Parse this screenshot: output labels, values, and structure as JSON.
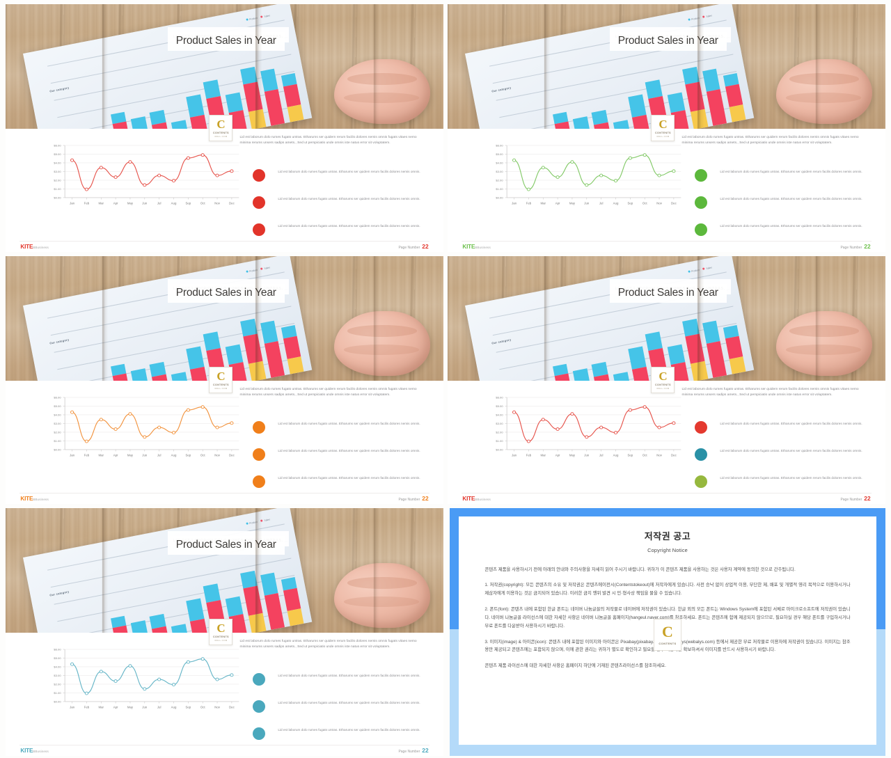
{
  "deck": {
    "slide_common": {
      "kicker": "LID EST LABORUM  DOLO  RUMES  FUGATS  UNTRAS.",
      "title": "Product Sales in Year",
      "lead_paragraph": "Lid est laborum dolo rumes fugats untras. Etharums ser quidem rerum facilis dolores nemis omnis fugats vitaes nemo minima rerums unsers sadips amets., Sed ut perspiciatis  unde omnis iste natus error sit voluptatem.",
      "bullet_text": "Lid est laborum dolo rumes fugats untras. Etharums ser quidem rerum facilis dolores nemis omnis.",
      "logo_letter": "C",
      "logo_name": "CONTENTS",
      "logo_sub": "MALL.COM",
      "paper_category_label": "Our category",
      "paper_legend": [
        "Product",
        "Sales"
      ],
      "footer": {
        "brand_bold": "KITE",
        "brand_light": "BBusiness",
        "page_label": "Page Number",
        "page_value": "22"
      }
    },
    "slides": [
      {
        "id": "slide-1",
        "accent": "#e2342a",
        "dots": [
          "#e2342a",
          "#e2342a",
          "#e2342a"
        ]
      },
      {
        "id": "slide-2",
        "accent": "#6cbf4b",
        "dots": [
          "#5cb83c",
          "#5cb83c",
          "#5cb83c"
        ]
      },
      {
        "id": "slide-3",
        "accent": "#f07f1a",
        "dots": [
          "#f07f1a",
          "#f07f1a",
          "#f07f1a"
        ]
      },
      {
        "id": "slide-4",
        "accent": "#e2342a",
        "dots": [
          "#e4392f",
          "#2a91a6",
          "#96b83e"
        ]
      },
      {
        "id": "slide-5",
        "accent": "#4aa8bd",
        "dots": [
          "#4aa8bd",
          "#4aa8bd",
          "#4aa8bd"
        ]
      }
    ]
  },
  "chart_data": {
    "type": "line",
    "title": "Product Sales in Year",
    "xlabel": "",
    "ylabel": "",
    "categories": [
      "Jan",
      "Feb",
      "Mar",
      "Apr",
      "May",
      "Jun",
      "Jul",
      "Aug",
      "Sep",
      "Oct",
      "Nov",
      "Dec"
    ],
    "values": [
      4.3,
      0.95,
      3.45,
      2.35,
      4.1,
      1.45,
      2.55,
      1.95,
      4.55,
      4.9,
      2.55,
      3.05
    ],
    "ytick_labels": [
      "$6.00",
      "$5.00",
      "$4.00",
      "$3.00",
      "$2.00",
      "$1.00",
      "$0.00"
    ],
    "ytick_values": [
      6,
      5,
      4,
      3,
      2,
      1,
      0
    ],
    "ylim": [
      0,
      6
    ],
    "grid": true,
    "legend": false,
    "markers": "open-circle",
    "series": [
      {
        "name": "Sales",
        "values": [
          4.3,
          0.95,
          3.45,
          2.35,
          4.1,
          1.45,
          2.55,
          1.95,
          4.55,
          4.9,
          2.55,
          3.05
        ]
      }
    ]
  },
  "paper_photo_chart": {
    "type": "bar",
    "stacked": true,
    "series": [
      {
        "name": "blue",
        "color": "#45c4e8"
      },
      {
        "name": "red",
        "color": "#f4425f"
      },
      {
        "name": "yellow",
        "color": "#f7c94b"
      }
    ]
  },
  "copyright": {
    "title": "저작권 공고",
    "subtitle": "Copyright Notice",
    "paragraphs": [
      "콘텐츠 제품을 사용하시기 전에 아래의 안내와 주의사항을 자세히 읽어 주시기 바랍니다. 귀하가 이 콘텐츠 제품을 사용하는 것은 사용자 계약에 동의한 것으로 간주됩니다.",
      "1. 저작권(copyright): 모든 콘텐츠의 소유 및 저작권은 콘텐츠에이전시(Contentstokeout)에 저작자에게 있습니다. 사전 승낙 없이 상업적 이용, 무단한 제, 배포 및 개별적 영리 목적으로 이용하시거나 제삼자에게 이용하는 것은 금지되어 있습니다. 이러한 금지 행위 발견 시 민·형사상 책임을 물을 수 있습니다.",
      "2. 폰트(font): 콘텐츠 내에 포함된 한글 폰트는 네이버 나눔글꼴의 저작물로 네이버에 저작권이 있습니다. 한글 외의 모든 폰트는 Windows System에 포함된 서체로 마이크로소프트에 저작권이 있습니다. 네이버 나눔글꼴 라이선스에 대한 자세한 사항은 네이버 나눔글꼴 홈페이지(hangeul.naver.com)를 참조하세요. 폰트는 콘텐츠에 함께 제공되지 않으므로, 필요하실 경우 해당 폰트를 구입하시거나 무료 폰트를 다운받아 사용하시기 바랍니다.",
      "3. 이미지(image) & 아이콘(icon): 콘텐츠 내에 포함된 이미지와 아이콘은 Pixabay(pixabay.com)와 Webalys(webalys.com) 등에서 제공한 무료 저작물로 이용자에 저작권이 있습니다. 이미지는 참조용만 제공되고 콘텐츠에는 포함되지 않으며, 이에 관한 권리는 귀하가 별도로 확인하고 필요할 경우 이용자를 확보하셔서 이미지를 반드시 사용하시기 바랍니다.",
      "콘텐츠 제품 라이선스에 대한 자세한 사항은 홈페이지 하단에 기재된 콘텐츠라이선스를 참조하세요."
    ],
    "logo_letter": "C",
    "logo_name": "CONTENTS"
  }
}
